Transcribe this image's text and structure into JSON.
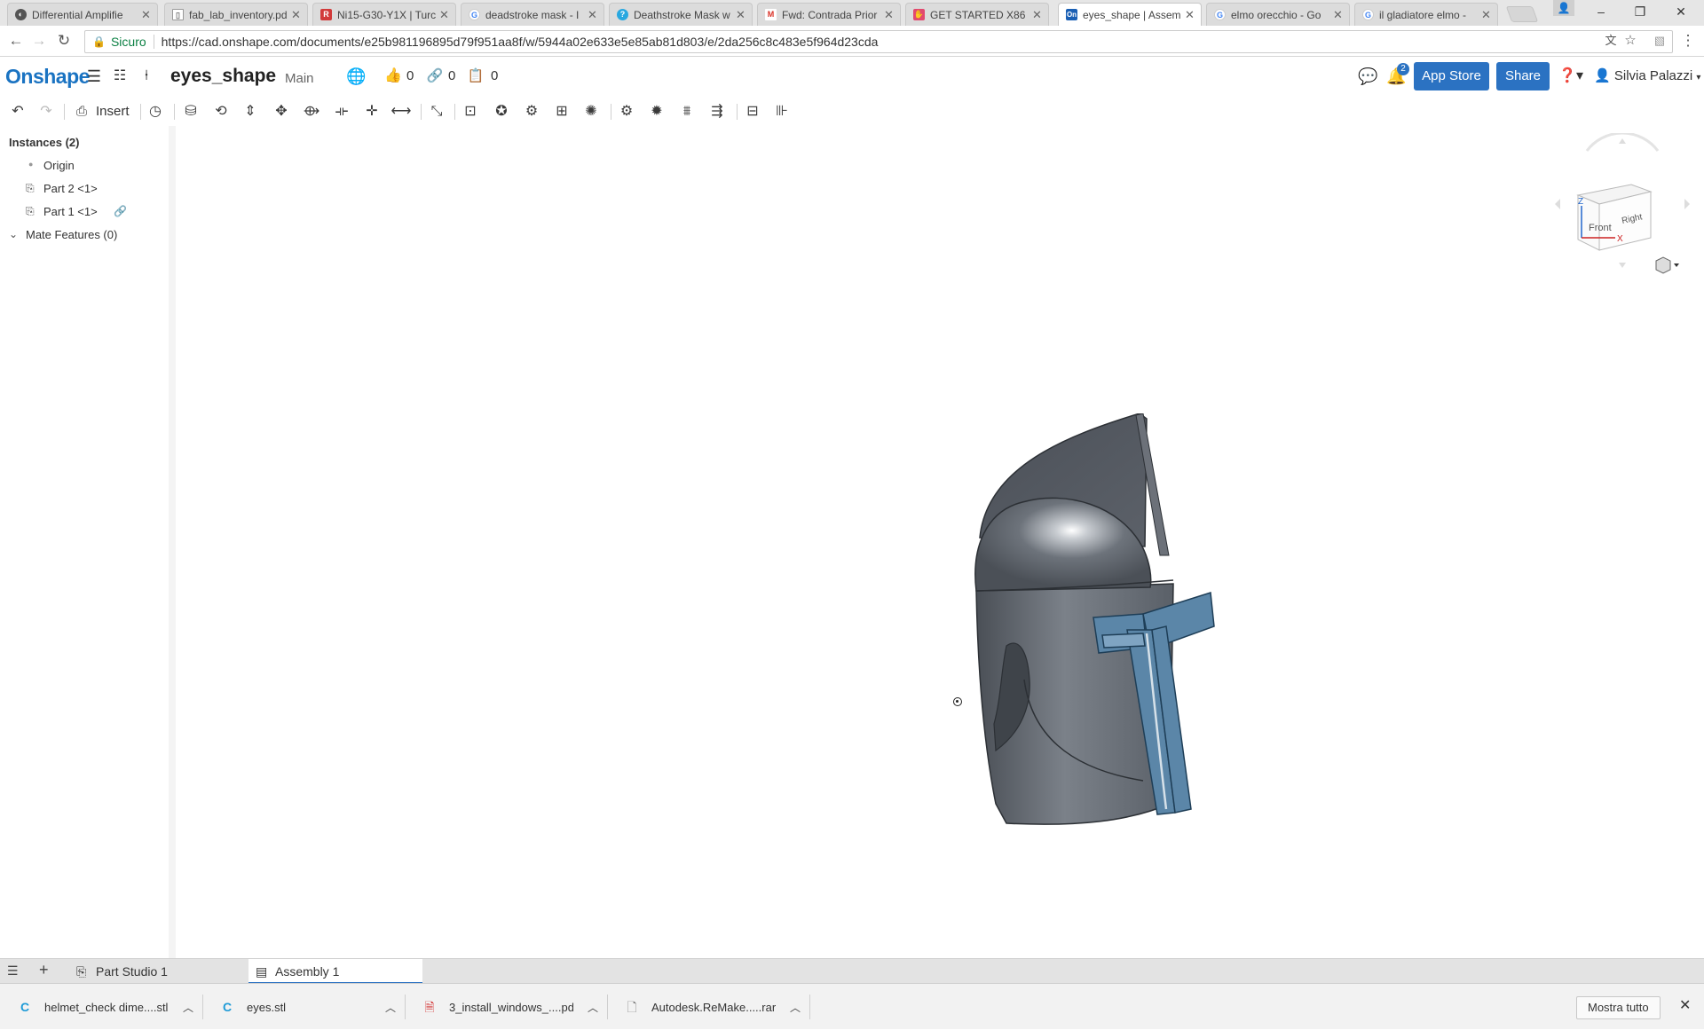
{
  "browser": {
    "tabs": [
      {
        "title": "Differential Amplifie",
        "fav_color": "#555555",
        "fav_glyph": "◐"
      },
      {
        "title": "fab_lab_inventory.pd",
        "fav_color": "#888888",
        "fav_glyph": "▯"
      },
      {
        "title": "Ni15-G30-Y1X | Turc",
        "fav_color": "#d23a3a",
        "fav_glyph": "R"
      },
      {
        "title": "deadstroke mask - I",
        "fav_color": "#4285f4",
        "fav_glyph": "G"
      },
      {
        "title": "Deathstroke Mask w",
        "fav_color": "#29a8e0",
        "fav_glyph": "?"
      },
      {
        "title": "Fwd: Contrada Prior",
        "fav_color": "#d93025",
        "fav_glyph": "M"
      },
      {
        "title": "GET STARTED X86 -",
        "fav_color": "#e2486f",
        "fav_glyph": "✋"
      },
      {
        "title": "eyes_shape | Assem",
        "fav_color": "#1a5fb4",
        "fav_glyph": "On"
      },
      {
        "title": "elmo orecchio - Go",
        "fav_color": "#4285f4",
        "fav_glyph": "G"
      },
      {
        "title": "il gladiatore elmo -",
        "fav_color": "#4285f4",
        "fav_glyph": "G"
      }
    ],
    "active_tab": 7,
    "secure_label": "Sicuro",
    "url": "https://cad.onshape.com/documents/e25b981196895d79f951aa8f/w/5944a02e633e5e85ab81d803/e/2da256c8c483e5f964d23cda"
  },
  "header": {
    "logo": "Onshape",
    "doc_title": "eyes_shape",
    "workspace": "Main",
    "likes": "0",
    "links": "0",
    "copies": "0",
    "notification_count": "2",
    "app_store_label": "App Store",
    "share_label": "Share",
    "user_name": "Silvia Palazzi"
  },
  "toolbar": {
    "insert_label": "Insert"
  },
  "tree": {
    "instances_header": "Instances (2)",
    "items": [
      "Origin",
      "Part 2 <1>",
      "Part 1 <1>"
    ],
    "mate_features": "Mate Features (0)"
  },
  "viewcube": {
    "front": "Front",
    "right": "Right",
    "z": "Z",
    "x": "X"
  },
  "bottom_tabs": [
    {
      "label": "Part Studio 1"
    },
    {
      "label": "Assembly 1"
    }
  ],
  "downloads": [
    {
      "name": "helmet_check dime....stl",
      "icon": "stl-file-icon"
    },
    {
      "name": "eyes.stl",
      "icon": "stl-file-icon"
    },
    {
      "name": "3_install_windows_....pdf",
      "icon": "pdf-file-icon"
    },
    {
      "name": "Autodesk.ReMake.....rar",
      "icon": "generic-file-icon"
    }
  ],
  "show_all_label": "Mostra tutto"
}
